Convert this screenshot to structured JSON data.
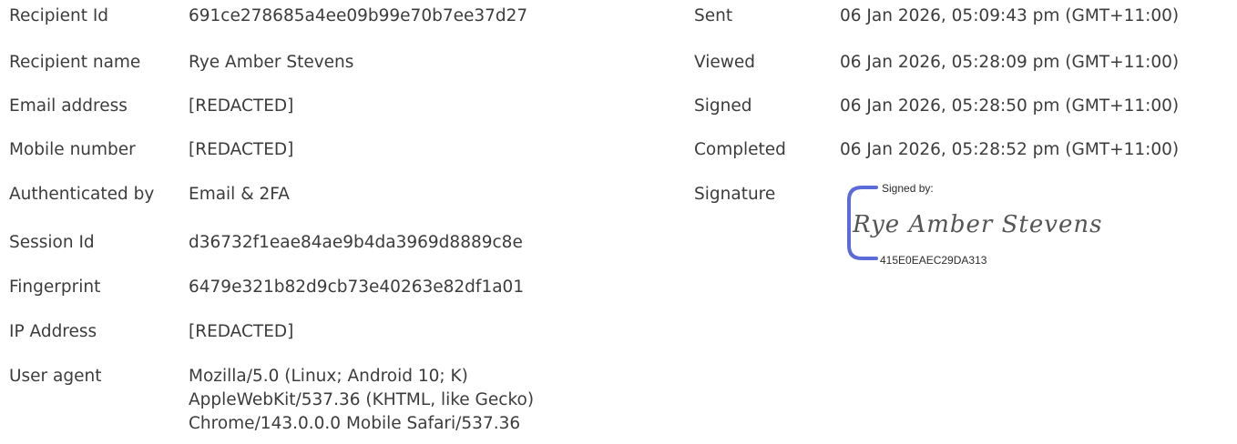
{
  "recipient": {
    "fields": [
      {
        "label": "Recipient Id",
        "value": "691ce278685a4ee09b99e70b7ee37d27"
      },
      {
        "label": "Recipient name",
        "value": "Rye Amber Stevens"
      },
      {
        "label": "Email address",
        "value": "[REDACTED]"
      },
      {
        "label": "Mobile number",
        "value": "[REDACTED]"
      },
      {
        "label": "Authenticated by",
        "value": "Email & 2FA"
      },
      {
        "label": "Session Id",
        "value": "d36732f1eae84ae9b4da3969d8889c8e"
      },
      {
        "label": "Fingerprint",
        "value": "6479e321b82d9cb73e40263e82df1a01"
      },
      {
        "label": "IP Address",
        "value": "[REDACTED]"
      },
      {
        "label": "User agent",
        "value": "Mozilla/5.0 (Linux; Android 10; K) AppleWebKit/537.36 (KHTML, like Gecko) Chrome/143.0.0.0 Mobile Safari/537.36"
      }
    ]
  },
  "events": {
    "fields": [
      {
        "label": "Sent",
        "value": "06 Jan 2026, 05:09:43 pm (GMT+11:00)"
      },
      {
        "label": "Viewed",
        "value": "06 Jan 2026, 05:28:09 pm (GMT+11:00)"
      },
      {
        "label": "Signed",
        "value": "06 Jan 2026, 05:28:50 pm (GMT+11:00)"
      },
      {
        "label": "Completed",
        "value": "06 Jan 2026, 05:28:52 pm (GMT+11:00)"
      },
      {
        "label": "Signature",
        "value": ""
      }
    ]
  },
  "signature": {
    "signed_by_label": "Signed by:",
    "signer_name": "Rye Amber Stevens",
    "signature_id": "415E0EAEC29DA313",
    "bracket_color": "#5b6bd8"
  }
}
